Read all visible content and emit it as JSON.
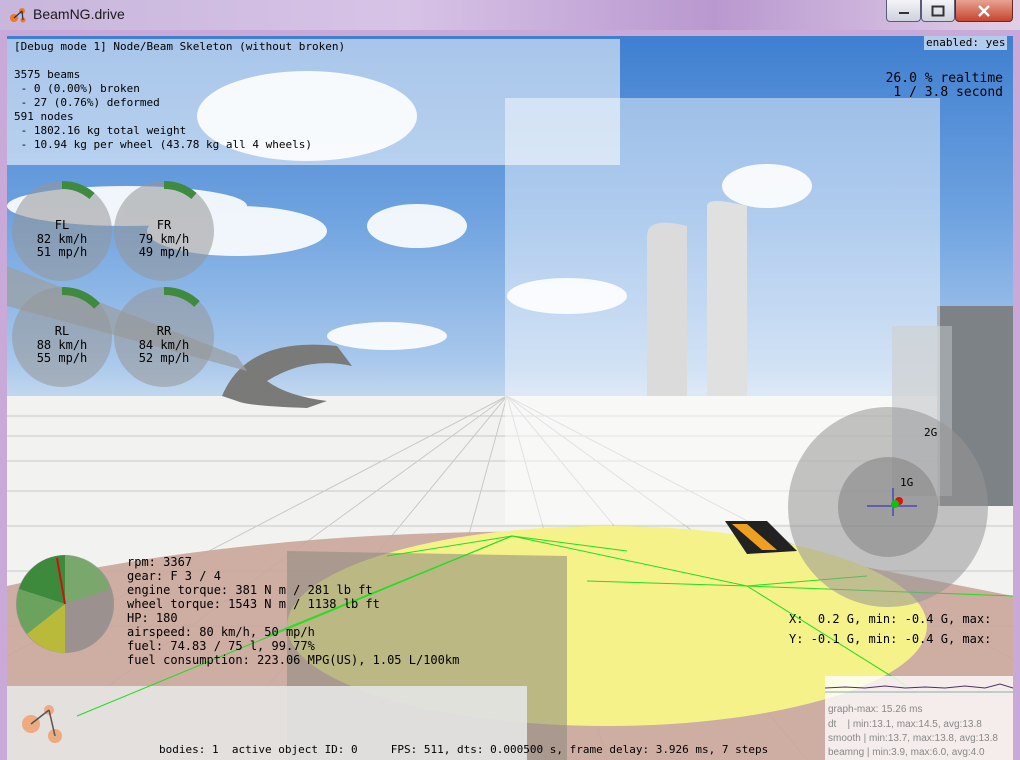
{
  "window": {
    "title": "BeamNG.drive",
    "app_icon": "beamng-logo-icon",
    "controls": {
      "minimize": "minimize-icon",
      "maximize": "maximize-icon",
      "close": "close-icon"
    }
  },
  "debug": {
    "header": "[Debug mode 1] Node/Beam Skeleton (without broken)",
    "enabled": "enabled: yes",
    "lines": [
      "3575 beams",
      " - 0 (0.00%) broken",
      " - 27 (0.76%) deformed",
      "591 nodes",
      " - 1802.16 kg total weight",
      " - 10.94 kg per wheel (43.78 kg all 4 wheels)"
    ]
  },
  "realtime": {
    "percent": "26.0 % realtime",
    "ratio": "1 / 3.8 second"
  },
  "wheels": [
    {
      "name": "FL",
      "kmh": "82 km/h",
      "mph": "51 mp/h"
    },
    {
      "name": "FR",
      "kmh": "79 km/h",
      "mph": "49 mp/h"
    },
    {
      "name": "RL",
      "kmh": "88 km/h",
      "mph": "55 mp/h"
    },
    {
      "name": "RR",
      "kmh": "84 km/h",
      "mph": "52 mp/h"
    }
  ],
  "vehicle": {
    "rpm": "rpm: 3367",
    "gear": "gear: F 3 / 4",
    "engine_torque": "engine torque: 381 N m / 281 lb ft",
    "wheel_torque": "wheel torque: 1543 N m / 1138 lb ft",
    "hp": "HP: 180",
    "airspeed": "airspeed: 80 km/h, 50 mp/h",
    "fuel": "fuel: 74.83 / 75 l, 99.77%",
    "consumption": "fuel consumption: 223.06 MPG(US), 1.05 L/100km"
  },
  "gforce": {
    "ring_outer": "2G",
    "ring_inner": "1G",
    "x": "X:  0.2 G, min: -0.4 G, max:",
    "y": "Y: -0.1 G, min: -0.4 G, max:"
  },
  "graph": {
    "max": "graph-max: 15.26 ms",
    "dt": "dt    | min:13.1, max:14.5, avg:13.8",
    "smooth": "smooth | min:13.7, max:13.8, avg:13.8",
    "beamng": "beamng | min:3.9, max:6.0, avg:4.0"
  },
  "status": {
    "text": "bodies: 1  active object ID: 0     FPS: 511, dts: 0.000500 s, frame delay: 3.926 ms, 7 steps"
  },
  "colors": {
    "wheel_arc": "#3f8a3f",
    "gforce_red": "#e01010",
    "gforce_green": "#10c010",
    "accent_blue": "#2020c0"
  }
}
